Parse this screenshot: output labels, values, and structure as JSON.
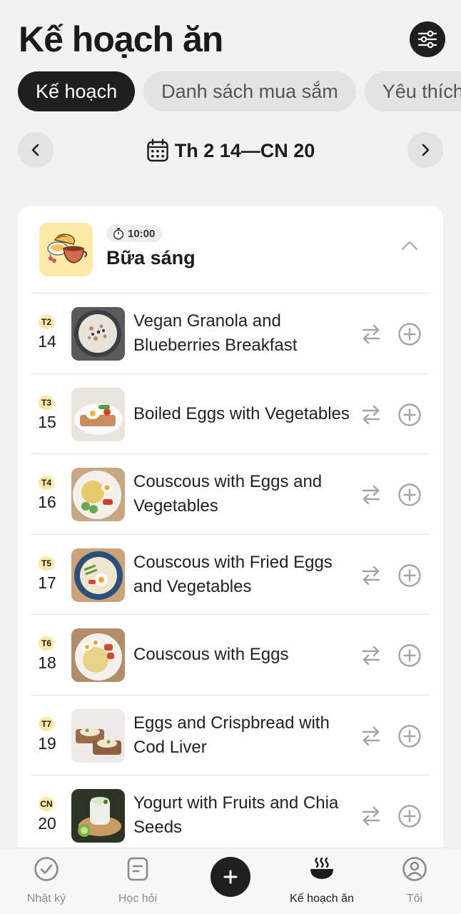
{
  "header": {
    "title": "Kế hoạch ăn"
  },
  "tabs": [
    {
      "label": "Kế hoạch",
      "active": true
    },
    {
      "label": "Danh sách mua sắm",
      "active": false
    },
    {
      "label": "Yêu thích",
      "active": false
    }
  ],
  "week": {
    "label": "Th 2 14—CN 20"
  },
  "meal": {
    "time": "10:00",
    "name": "Bữa sáng",
    "expanded": true
  },
  "days": [
    {
      "day": "T2",
      "date": "14",
      "dish": "Vegan Granola and Blueberries Breakfast"
    },
    {
      "day": "T3",
      "date": "15",
      "dish": "Boiled Eggs with Vegetables"
    },
    {
      "day": "T4",
      "date": "16",
      "dish": "Couscous with Eggs and Vegetables"
    },
    {
      "day": "T5",
      "date": "17",
      "dish": "Couscous with Fried Eggs and Vegetables"
    },
    {
      "day": "T6",
      "date": "18",
      "dish": "Couscous with Eggs"
    },
    {
      "day": "T7",
      "date": "19",
      "dish": "Eggs and Crispbread with Cod Liver"
    },
    {
      "day": "CN",
      "date": "20",
      "dish": "Yogurt with Fruits and Chia Seeds"
    }
  ],
  "nav": {
    "diary": "Nhật ký",
    "learn": "Học hỏi",
    "meal_plan": "Kế hoạch ăn",
    "me": "Tôi"
  },
  "colors": {
    "accent_dark": "#1f1f1f",
    "day_badge": "#fde9a8",
    "meal_icon_bg": "#fde9a8"
  },
  "icons": {
    "filter": "sliders-icon",
    "prev": "chevron-left-icon",
    "next": "chevron-right-icon",
    "calendar": "calendar-icon",
    "swap": "swap-arrows-icon",
    "add": "plus-circle-icon",
    "collapse": "chevron-up-icon"
  }
}
